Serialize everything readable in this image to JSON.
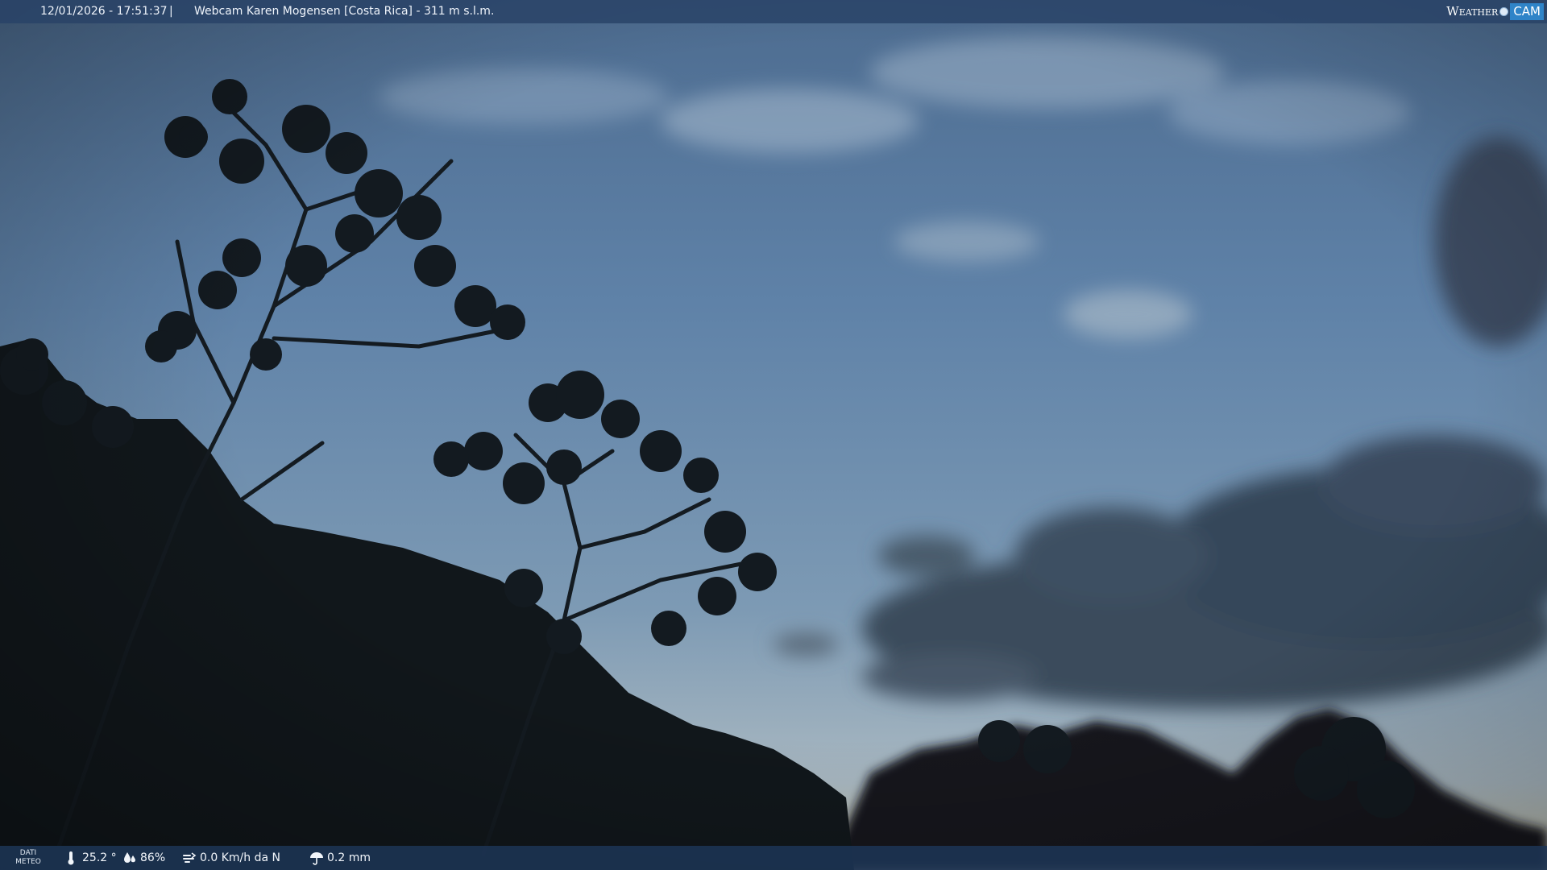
{
  "header": {
    "timestamp": "12/01/2026 - 17:51:37",
    "separator": "|",
    "camera_title": "Webcam Karen Mogensen [Costa Rica] - 311 m s.l.m.",
    "logo_weather": "Weather",
    "logo_cam": "CAM"
  },
  "footer": {
    "dati_line1": "DATI",
    "dati_line2": "METEO",
    "temperature": "25.2 °",
    "humidity": "86%",
    "wind": "0.0 Km/h da N",
    "rain": "0.2 mm"
  },
  "icons": {
    "temperature": "thermometer-icon",
    "humidity": "humidity-drops-icon",
    "wind": "wind-icon",
    "rain": "rain-umbrella-icon"
  },
  "colors": {
    "sky_top": "#4a6f99",
    "sky_bottom": "#9eb4c6",
    "foliage": "#10161a",
    "bar": "#284266",
    "logo_cam_bg": "#2f84c8"
  }
}
